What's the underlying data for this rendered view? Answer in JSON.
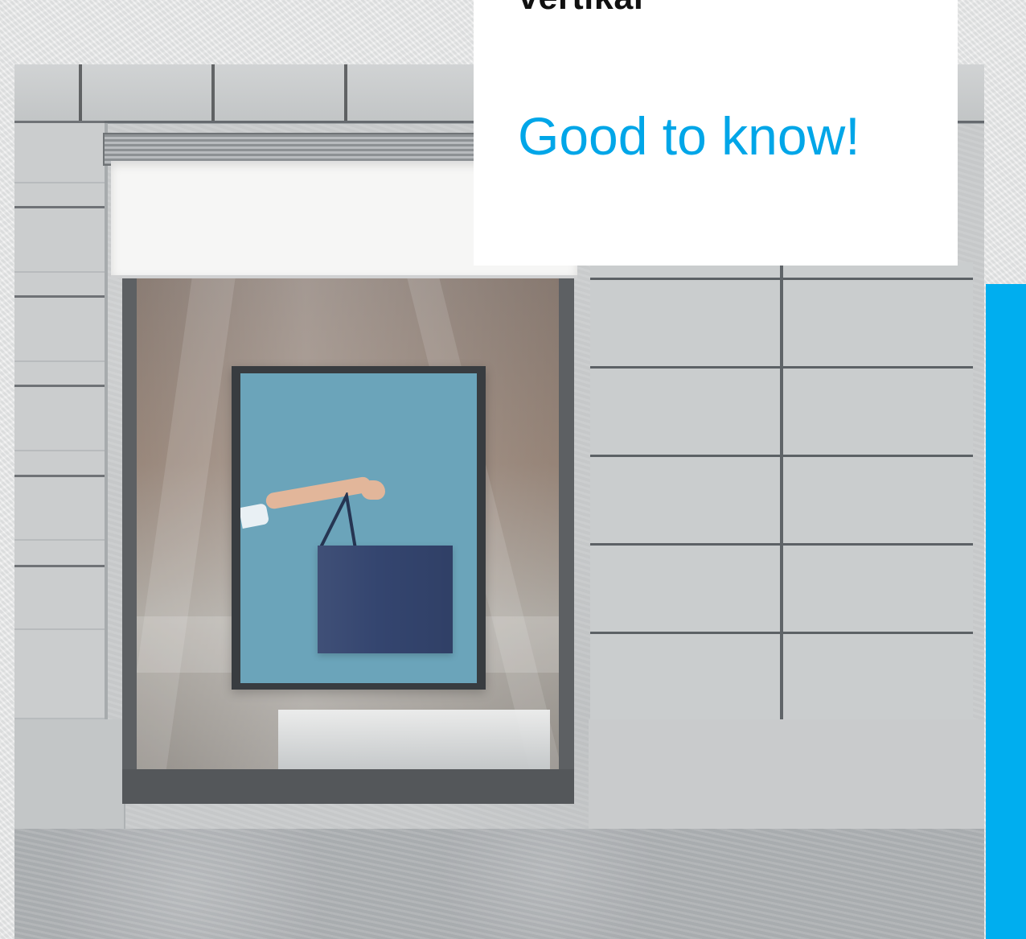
{
  "card": {
    "kicker": "vertikal",
    "heading": "Good to know!"
  },
  "colors": {
    "accent": "#00AEEF",
    "headline": "#00A6E8",
    "card_background": "#FFFFFF",
    "kicker_text": "#111111"
  },
  "image": {
    "subject": "storefront window with shopping bag poster"
  }
}
